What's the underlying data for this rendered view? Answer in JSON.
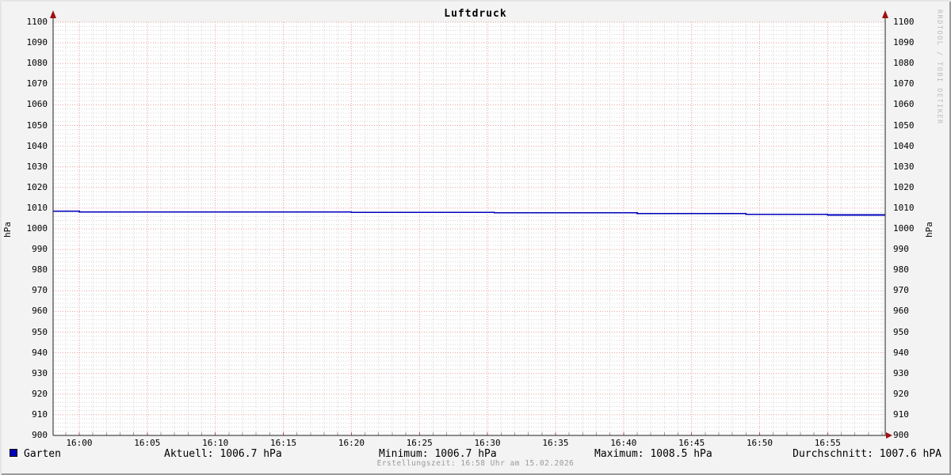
{
  "chart_data": {
    "type": "line",
    "title": "Luftdruck",
    "ylabel_left": "hPa",
    "ylabel_right": "hPa",
    "ylim": [
      900,
      1100
    ],
    "y_tick_step": 10,
    "y_minor_step": 2,
    "xlim_minutes": [
      -1.9,
      59.2
    ],
    "x_minor_step_minutes": 1,
    "x_ticks": [
      {
        "label": "16:00",
        "minute": 0
      },
      {
        "label": "16:05",
        "minute": 5
      },
      {
        "label": "16:10",
        "minute": 10
      },
      {
        "label": "16:15",
        "minute": 15
      },
      {
        "label": "16:20",
        "minute": 20
      },
      {
        "label": "16:25",
        "minute": 25
      },
      {
        "label": "16:30",
        "minute": 30
      },
      {
        "label": "16:35",
        "minute": 35
      },
      {
        "label": "16:40",
        "minute": 40
      },
      {
        "label": "16:45",
        "minute": 45
      },
      {
        "label": "16:50",
        "minute": 50
      },
      {
        "label": "16:55",
        "minute": 55
      }
    ],
    "grid": true,
    "legend_position": "bottom",
    "series": [
      {
        "name": "Garten",
        "color": "#0000be",
        "style": "step-after",
        "points_minutes_hpa": [
          [
            -1.9,
            1008.5
          ],
          [
            0,
            1008.2
          ],
          [
            10,
            1008.1
          ],
          [
            20,
            1008.0
          ],
          [
            30.5,
            1007.7
          ],
          [
            41,
            1007.4
          ],
          [
            49,
            1007.0
          ],
          [
            55,
            1006.7
          ],
          [
            59.2,
            1006.7
          ]
        ]
      }
    ],
    "colors": {
      "background": "#f3f3f3",
      "canvas": "#ffffff",
      "major_grid": "#e89c9c",
      "minor_grid": "#d4d4d4",
      "axis": "#1f1f1f",
      "arrow": "#a01010"
    }
  },
  "legend": {
    "aktuell": "Aktuell: 1006.7 hPa",
    "minimum": "Minimum: 1006.7 hPa",
    "maximum": "Maximum: 1008.5 hPa",
    "durchschnitt": "Durchschnitt: 1007.6 hPA"
  },
  "footer": {
    "created": "Erstellungszeit: 16:58 Uhr am 15.02.2026"
  },
  "watermark": "RRDTOOL / TOBI OETIKER"
}
